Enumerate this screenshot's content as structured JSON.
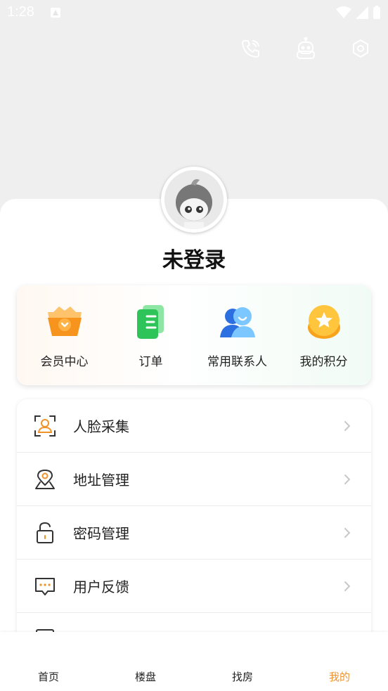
{
  "status_bar": {
    "time": "1:28"
  },
  "top_actions": {
    "icons": [
      "phone-icon",
      "robot-icon",
      "settings-icon"
    ]
  },
  "profile": {
    "name": "未登录"
  },
  "quick_actions": [
    {
      "label": "会员中心",
      "icon": "crown-icon"
    },
    {
      "label": "订单",
      "icon": "order-icon"
    },
    {
      "label": "常用联系人",
      "icon": "contacts-icon"
    },
    {
      "label": "我的积分",
      "icon": "points-icon"
    }
  ],
  "menu": [
    {
      "label": "人脸采集",
      "icon": "face-scan-icon"
    },
    {
      "label": "地址管理",
      "icon": "location-icon"
    },
    {
      "label": "密码管理",
      "icon": "lock-icon"
    },
    {
      "label": "用户反馈",
      "icon": "feedback-icon"
    }
  ],
  "bottom_nav": [
    {
      "label": "首页"
    },
    {
      "label": "楼盘"
    },
    {
      "label": "找房"
    },
    {
      "label": "我的"
    }
  ],
  "colors": {
    "accent": "#f0932b",
    "background": "#efefef"
  }
}
